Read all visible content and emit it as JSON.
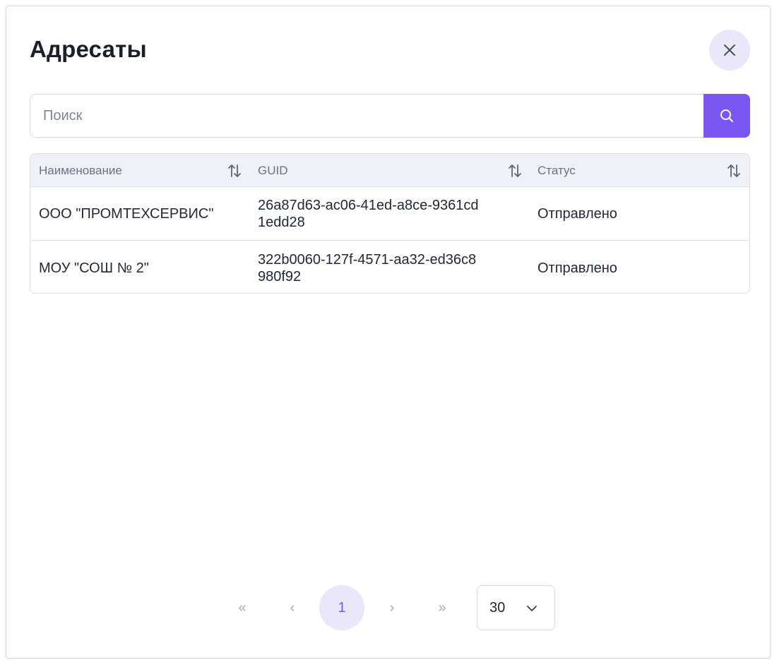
{
  "dialog": {
    "title": "Адресаты",
    "close_icon": "close-icon"
  },
  "search": {
    "placeholder": "Поиск",
    "value": "",
    "button_icon": "search-icon"
  },
  "table": {
    "columns": [
      {
        "label": "Наименование",
        "sort_icon": "sort-icon"
      },
      {
        "label": "GUID",
        "sort_icon": "sort-icon"
      },
      {
        "label": "Статус",
        "sort_icon": "sort-icon"
      }
    ],
    "rows": [
      {
        "name": "ООО \"ПРОМТЕХСЕРВИС\"",
        "guid": "26a87d63-ac06-41ed-a8ce-9361cd1edd28",
        "status": "Отправлено"
      },
      {
        "name": "МОУ \"СОШ № 2\"",
        "guid": "322b0060-127f-4571-aa32-ed36c8980f92",
        "status": "Отправлено"
      }
    ]
  },
  "pagination": {
    "first": "«",
    "prev": "‹",
    "current_page": "1",
    "next": "›",
    "last": "»",
    "page_size": "30",
    "page_size_icon": "chevron-down-icon"
  },
  "colors": {
    "accent": "#7b56f0",
    "accent_light": "#ebe7fb",
    "header_bg": "#eef1f6"
  }
}
